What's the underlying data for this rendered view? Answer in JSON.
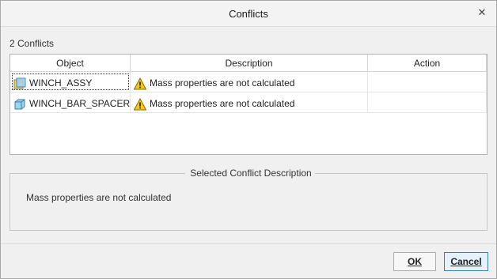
{
  "window": {
    "title": "Conflicts",
    "close_glyph": "✕"
  },
  "summary": {
    "count_text": "2 Conflicts"
  },
  "table": {
    "columns": [
      "Object",
      "Description",
      "Action"
    ],
    "rows": [
      {
        "object": "WINCH_ASSY",
        "object_icon": "assembly-icon",
        "status_icon": "warning-icon",
        "description": "Mass properties are not calculated",
        "action": ""
      },
      {
        "object": "WINCH_BAR_SPACER",
        "object_icon": "part-icon",
        "status_icon": "warning-icon",
        "description": "Mass properties are not calculated",
        "action": ""
      }
    ]
  },
  "details": {
    "title": "Selected Conflict Description",
    "text": "Mass properties are not calculated"
  },
  "buttons": {
    "ok": "OK",
    "cancel": "Cancel"
  },
  "colors": {
    "warning": "#f5c518",
    "focus_border": "#3c7fb1"
  }
}
